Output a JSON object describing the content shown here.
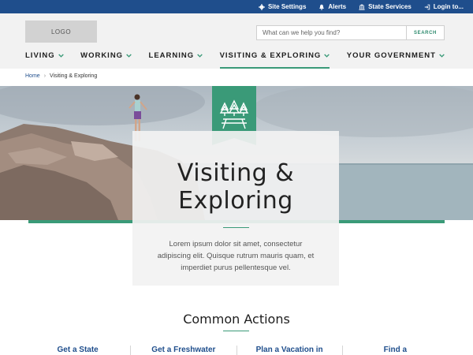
{
  "utility_bar": {
    "items": [
      {
        "label": "Site Settings",
        "icon": "gear-icon"
      },
      {
        "label": "Alerts",
        "icon": "bell-icon"
      },
      {
        "label": "State Services",
        "icon": "building-icon"
      },
      {
        "label": "Login to...",
        "icon": "login-icon"
      }
    ],
    "background_color": "#1f4e8c"
  },
  "header": {
    "logo_text": "LOGO",
    "search": {
      "placeholder": "What can we help you find?",
      "value": "",
      "button_label": "SEARCH"
    },
    "nav": [
      {
        "label": "LIVING",
        "active": false
      },
      {
        "label": "WORKING",
        "active": false
      },
      {
        "label": "LEARNING",
        "active": false
      },
      {
        "label": "VISITING & EXPLORING",
        "active": true
      },
      {
        "label": "YOUR GOVERNMENT",
        "active": false
      }
    ]
  },
  "breadcrumb": {
    "home": "Home",
    "separator": "›",
    "current": "Visiting & Exploring"
  },
  "hero": {
    "badge_icon": "picnic-table-trees-icon",
    "title_line1": "Visiting &",
    "title_line2": "Exploring",
    "description": "Lorem ipsum dolor sit amet, consectetur adipiscing elit. Quisque rutrum mauris quam, et imperdiet purus pellentesque vel.",
    "accent_color": "#3a9a78"
  },
  "common_actions": {
    "title": "Common Actions",
    "items": [
      {
        "label": "Get a State"
      },
      {
        "label": "Get a Freshwater"
      },
      {
        "label": "Plan a Vacation in"
      },
      {
        "label": "Find a"
      }
    ]
  }
}
